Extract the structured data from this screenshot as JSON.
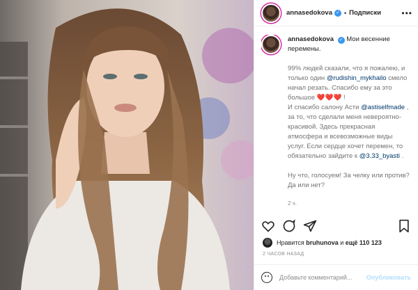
{
  "header": {
    "username": "annasedokova",
    "separator": "•",
    "follow_label": "Подписки",
    "more_label": "•••"
  },
  "caption": {
    "username": "annasedokova",
    "lead": "Мои весенние перемены.",
    "p1_a": "99% людей сказали, что я пожалею, и только один",
    "mention1": "@rudishin_mykhailo",
    "p1_b": "смело начал резать. Спасибо ему за это большое",
    "hearts": "❤️❤️❤️",
    "p1_c": "!",
    "p2_a": "И спасибо салону Асти",
    "mention2": "@astiselfmade",
    "p2_b": ", за то, что сделали меня невероятно-красивой. Здесь прекрасная атмосфера и всевозможные виды услуг. Если сердце хочет перемен, то обязательно зайдите к",
    "mention3": "@3.33_byasti",
    "p2_c": ".",
    "p3": "Ну что, голосуем! За челку или против? Да или нет?",
    "time": "2 ч."
  },
  "icons": [
    "heart-icon",
    "comment-icon",
    "share-icon",
    "bookmark-icon",
    "emoji-icon",
    "verified-icon"
  ],
  "likes": {
    "prefix": "Нравится",
    "user": "bruhunova",
    "mid": "и",
    "count": "ещё 110 123"
  },
  "posted_ago": "2 ЧАСОВ НАЗАД",
  "add_comment": {
    "placeholder": "Добавьте комментарий...",
    "publish_label": "Опубликовать"
  },
  "colors": {
    "verified": "#3897f0",
    "mention": "#00376b",
    "heart": "#ed4956",
    "publish_disabled": "#b2dffc"
  }
}
